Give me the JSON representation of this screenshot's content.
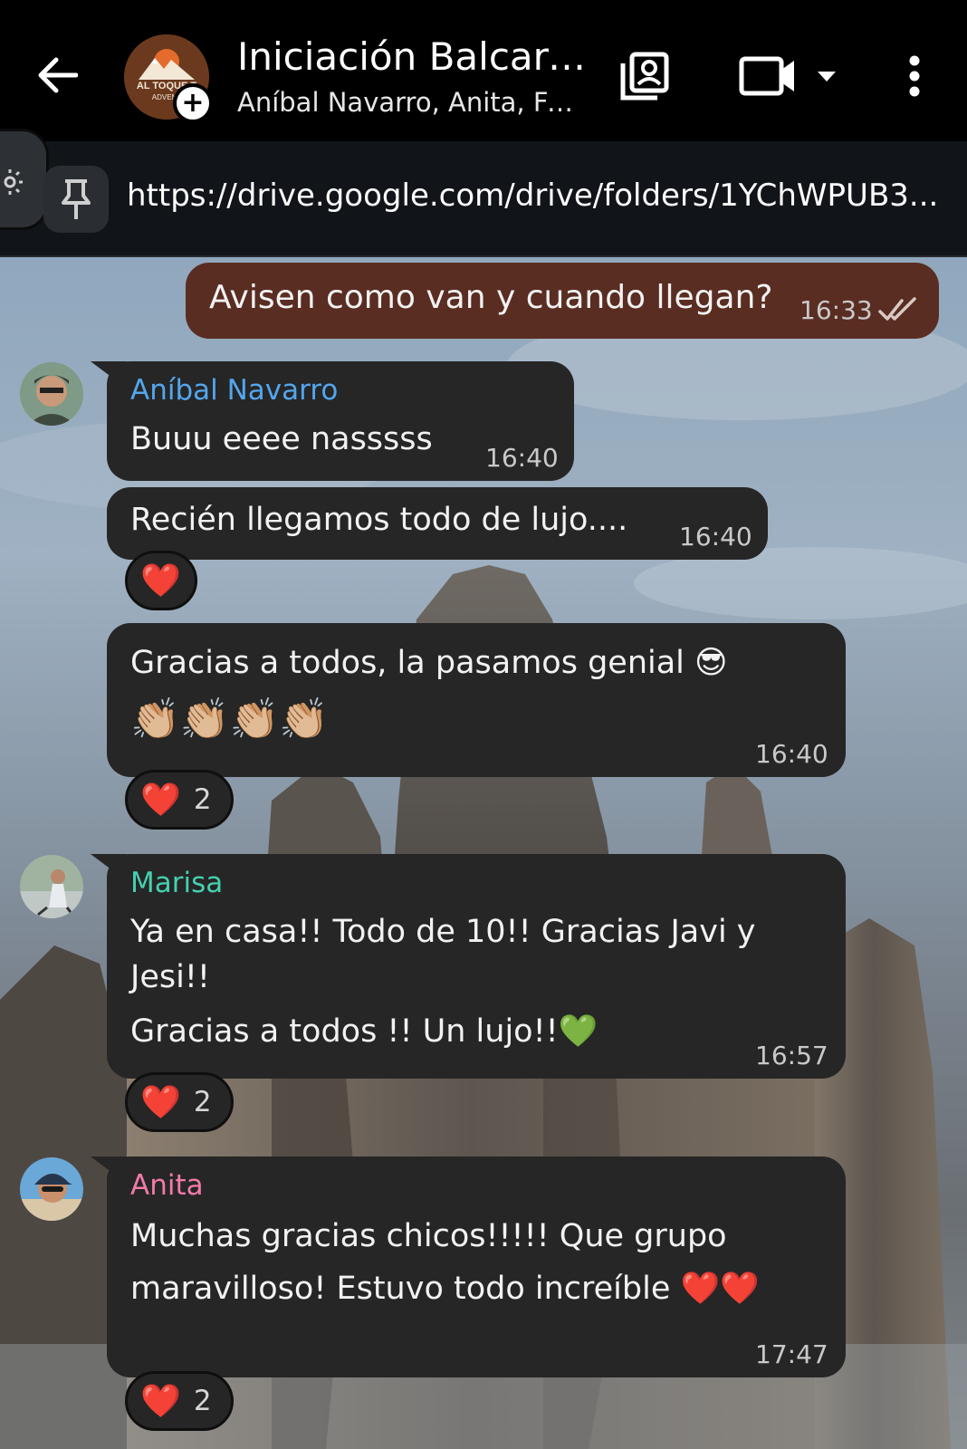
{
  "header": {
    "title": "Iniciación Balcarc...",
    "subtitle": "Aníbal Navarro, Anita, Fe...",
    "group_logo_text": "AL TOQUE T\nADVENT"
  },
  "pinned": {
    "link": "https://drive.google.com/drive/folders/1YChWPUB3..."
  },
  "messages": [
    {
      "direction": "outgoing",
      "text": "Avisen como van y cuando llegan?",
      "time": "16:33",
      "status": "read"
    },
    {
      "sender": "Aníbal Navarro",
      "sender_color": "#53a6ee",
      "text": "Buuu eeee nasssss",
      "time": "16:40"
    },
    {
      "sender": "Aníbal Navarro",
      "text": "Recién llegamos todo de lujo....",
      "time": "16:40",
      "reaction": {
        "emoji": "❤️",
        "count": ""
      }
    },
    {
      "sender": "Aníbal Navarro",
      "text_line1": "Gracias a todos, la pasamos genial 😎",
      "text_line2": "👏🏼👏🏼👏🏼👏🏼",
      "time": "16:40",
      "reaction": {
        "emoji": "❤️",
        "count": "2"
      }
    },
    {
      "sender": "Marisa",
      "sender_color": "#45d0b0",
      "text_line1": "Ya en casa!! Todo de 10!! Gracias  Javi y",
      "text_line2": "Jesi!!",
      "text_line3": "Gracias   a todos  !! Un lujo!!💚",
      "time": "16:57",
      "reaction": {
        "emoji": "❤️",
        "count": "2"
      }
    },
    {
      "sender": "Anita",
      "sender_color": "#f27aa9",
      "text_line1": "Muchas gracias chicos!!!!! Que grupo",
      "text_line2": "maravilloso! Estuvo todo increíble ❤️❤️",
      "time": "17:47",
      "reaction": {
        "emoji": "❤️",
        "count": "2"
      }
    }
  ],
  "colors": {
    "outgoing_bubble": "#5a2d22",
    "incoming_bubble": "#262626",
    "header_bg": "#000000"
  }
}
